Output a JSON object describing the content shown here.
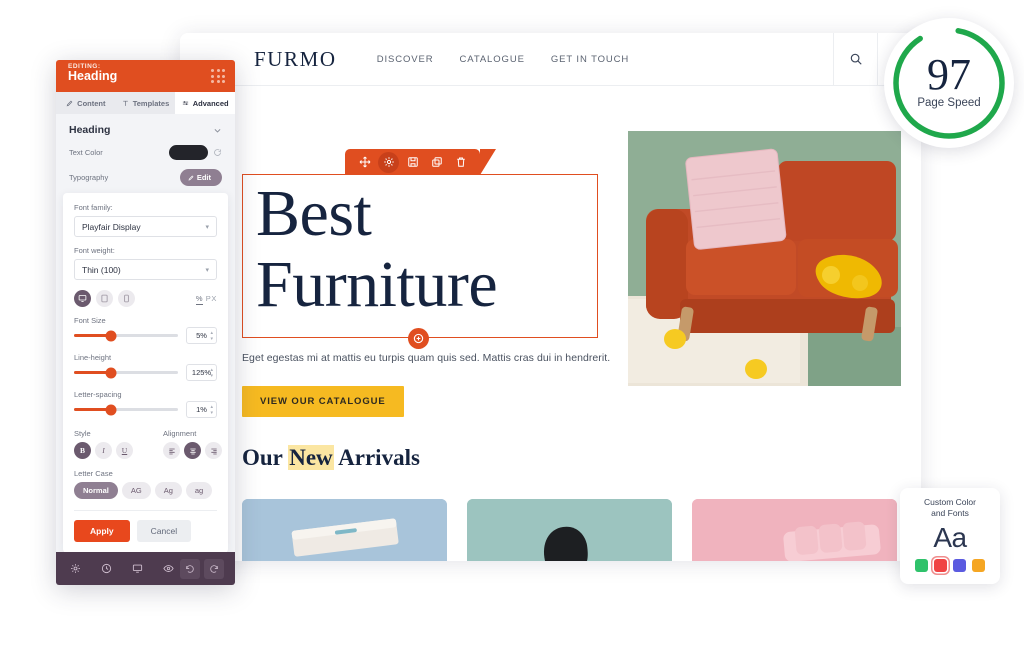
{
  "editor_panel": {
    "eyebrow": "EDITING:",
    "title": "Heading",
    "drag_handle_icon": "grid-dots-icon",
    "tabs": [
      {
        "label": "Content",
        "icon": "pencil-icon",
        "active": false
      },
      {
        "label": "Templates",
        "icon": "templates-icon",
        "active": false
      },
      {
        "label": "Advanced",
        "icon": "sliders-icon",
        "active": true
      }
    ],
    "section_title": "Heading",
    "collapse_icon": "chevron-down-icon",
    "text_color": {
      "label": "Text Color",
      "swatch_hex": "#23242A",
      "reset_icon": "reset-icon"
    },
    "typography": {
      "label": "Typography",
      "edit_label": "Edit",
      "edit_icon": "pencil-icon"
    },
    "font_family": {
      "label": "Font family:",
      "value": "Playfair Display"
    },
    "font_weight": {
      "label": "Font weight:",
      "value": "Thin (100)"
    },
    "devices": [
      {
        "name": "desktop",
        "icon": "desktop-icon",
        "active": true
      },
      {
        "name": "tablet",
        "icon": "tablet-icon",
        "active": false
      },
      {
        "name": "mobile",
        "icon": "mobile-icon",
        "active": false
      }
    ],
    "units": {
      "percent": "%",
      "px": "PX",
      "active": "%"
    },
    "sliders": [
      {
        "label": "Font Size",
        "value": "5%",
        "fill_pct": 36
      },
      {
        "label": "Line-height",
        "value": "125%",
        "fill_pct": 36
      },
      {
        "label": "Letter-spacing",
        "value": "1%",
        "fill_pct": 36
      }
    ],
    "style": {
      "label": "Style",
      "buttons": [
        {
          "label": "B",
          "name": "bold",
          "active": true
        },
        {
          "label": "I",
          "name": "italic",
          "active": false
        },
        {
          "label": "U",
          "name": "underline",
          "active": false
        }
      ]
    },
    "alignment": {
      "label": "Alignment",
      "buttons": [
        {
          "name": "align-left",
          "icon": "align-left-icon",
          "active": false
        },
        {
          "name": "align-center",
          "icon": "align-center-icon",
          "active": true
        },
        {
          "name": "align-right",
          "icon": "align-right-icon",
          "active": false
        }
      ]
    },
    "letter_case": {
      "label": "Letter Case",
      "options": [
        {
          "label": "Normal",
          "active": true
        },
        {
          "label": "AG",
          "active": false
        },
        {
          "label": "Ag",
          "active": false
        },
        {
          "label": "ag",
          "active": false
        }
      ]
    },
    "apply_label": "Apply",
    "cancel_label": "Cancel",
    "footer_icons": [
      {
        "name": "settings",
        "icon": "gear-icon"
      },
      {
        "name": "history",
        "icon": "history-clock-icon"
      },
      {
        "name": "responsive",
        "icon": "monitor-icon"
      },
      {
        "name": "preview",
        "icon": "eye-icon"
      },
      {
        "name": "undo",
        "icon": "undo-icon"
      },
      {
        "name": "redo",
        "icon": "redo-icon"
      }
    ]
  },
  "site": {
    "brand": "FURMO",
    "nav": [
      {
        "label": "DISCOVER"
      },
      {
        "label": "CATALOGUE"
      },
      {
        "label": "GET IN TOUCH"
      }
    ],
    "header_actions": [
      {
        "name": "search",
        "icon": "search-icon"
      },
      {
        "name": "cart",
        "icon": "shopping-bag-icon"
      }
    ],
    "hero": {
      "selection_toolbar": [
        {
          "name": "move",
          "icon": "move-arrows-icon",
          "active": false
        },
        {
          "name": "settings",
          "icon": "gear-icon",
          "active": true
        },
        {
          "name": "save-template",
          "icon": "save-icon",
          "active": false
        },
        {
          "name": "duplicate",
          "icon": "copy-icon",
          "active": false
        },
        {
          "name": "delete",
          "icon": "trash-icon",
          "active": false
        }
      ],
      "heading_line1": "Best",
      "heading_line2": "Furniture",
      "add_block_icon": "plus-circle-icon",
      "subtitle": "Eget egestas mi at mattis eu turpis quam quis sed. Mattis cras dui in hendrerit.",
      "cta_label": "VIEW OUR CATALOGUE",
      "cta_hex": "#F6BA21",
      "image_alt": "orange-sofa-photo"
    },
    "arrivals": {
      "title_before": "Our ",
      "title_highlight": "New",
      "title_after": " Arrivals",
      "highlight_hex": "#FBE6A2",
      "cards": [
        {
          "name": "card-blue",
          "hex": "#A8C4DA"
        },
        {
          "name": "card-teal",
          "hex": "#9CC4BF"
        },
        {
          "name": "card-pink",
          "hex": "#F0B3BE"
        }
      ]
    }
  },
  "page_speed": {
    "score": "97",
    "label": "Page Speed",
    "ring_hex": "#1FA84B",
    "ring_pct": 88
  },
  "custom_color_widget": {
    "title_line1": "Custom Color",
    "title_line2": "and Fonts",
    "sample": "Aa",
    "swatches": [
      {
        "name": "green",
        "hex": "#2FC26B",
        "selected": false
      },
      {
        "name": "red",
        "hex": "#F04444",
        "selected": true
      },
      {
        "name": "blue",
        "hex": "#5B5BE0",
        "selected": false
      },
      {
        "name": "orange",
        "hex": "#F5A623",
        "selected": false
      }
    ]
  }
}
